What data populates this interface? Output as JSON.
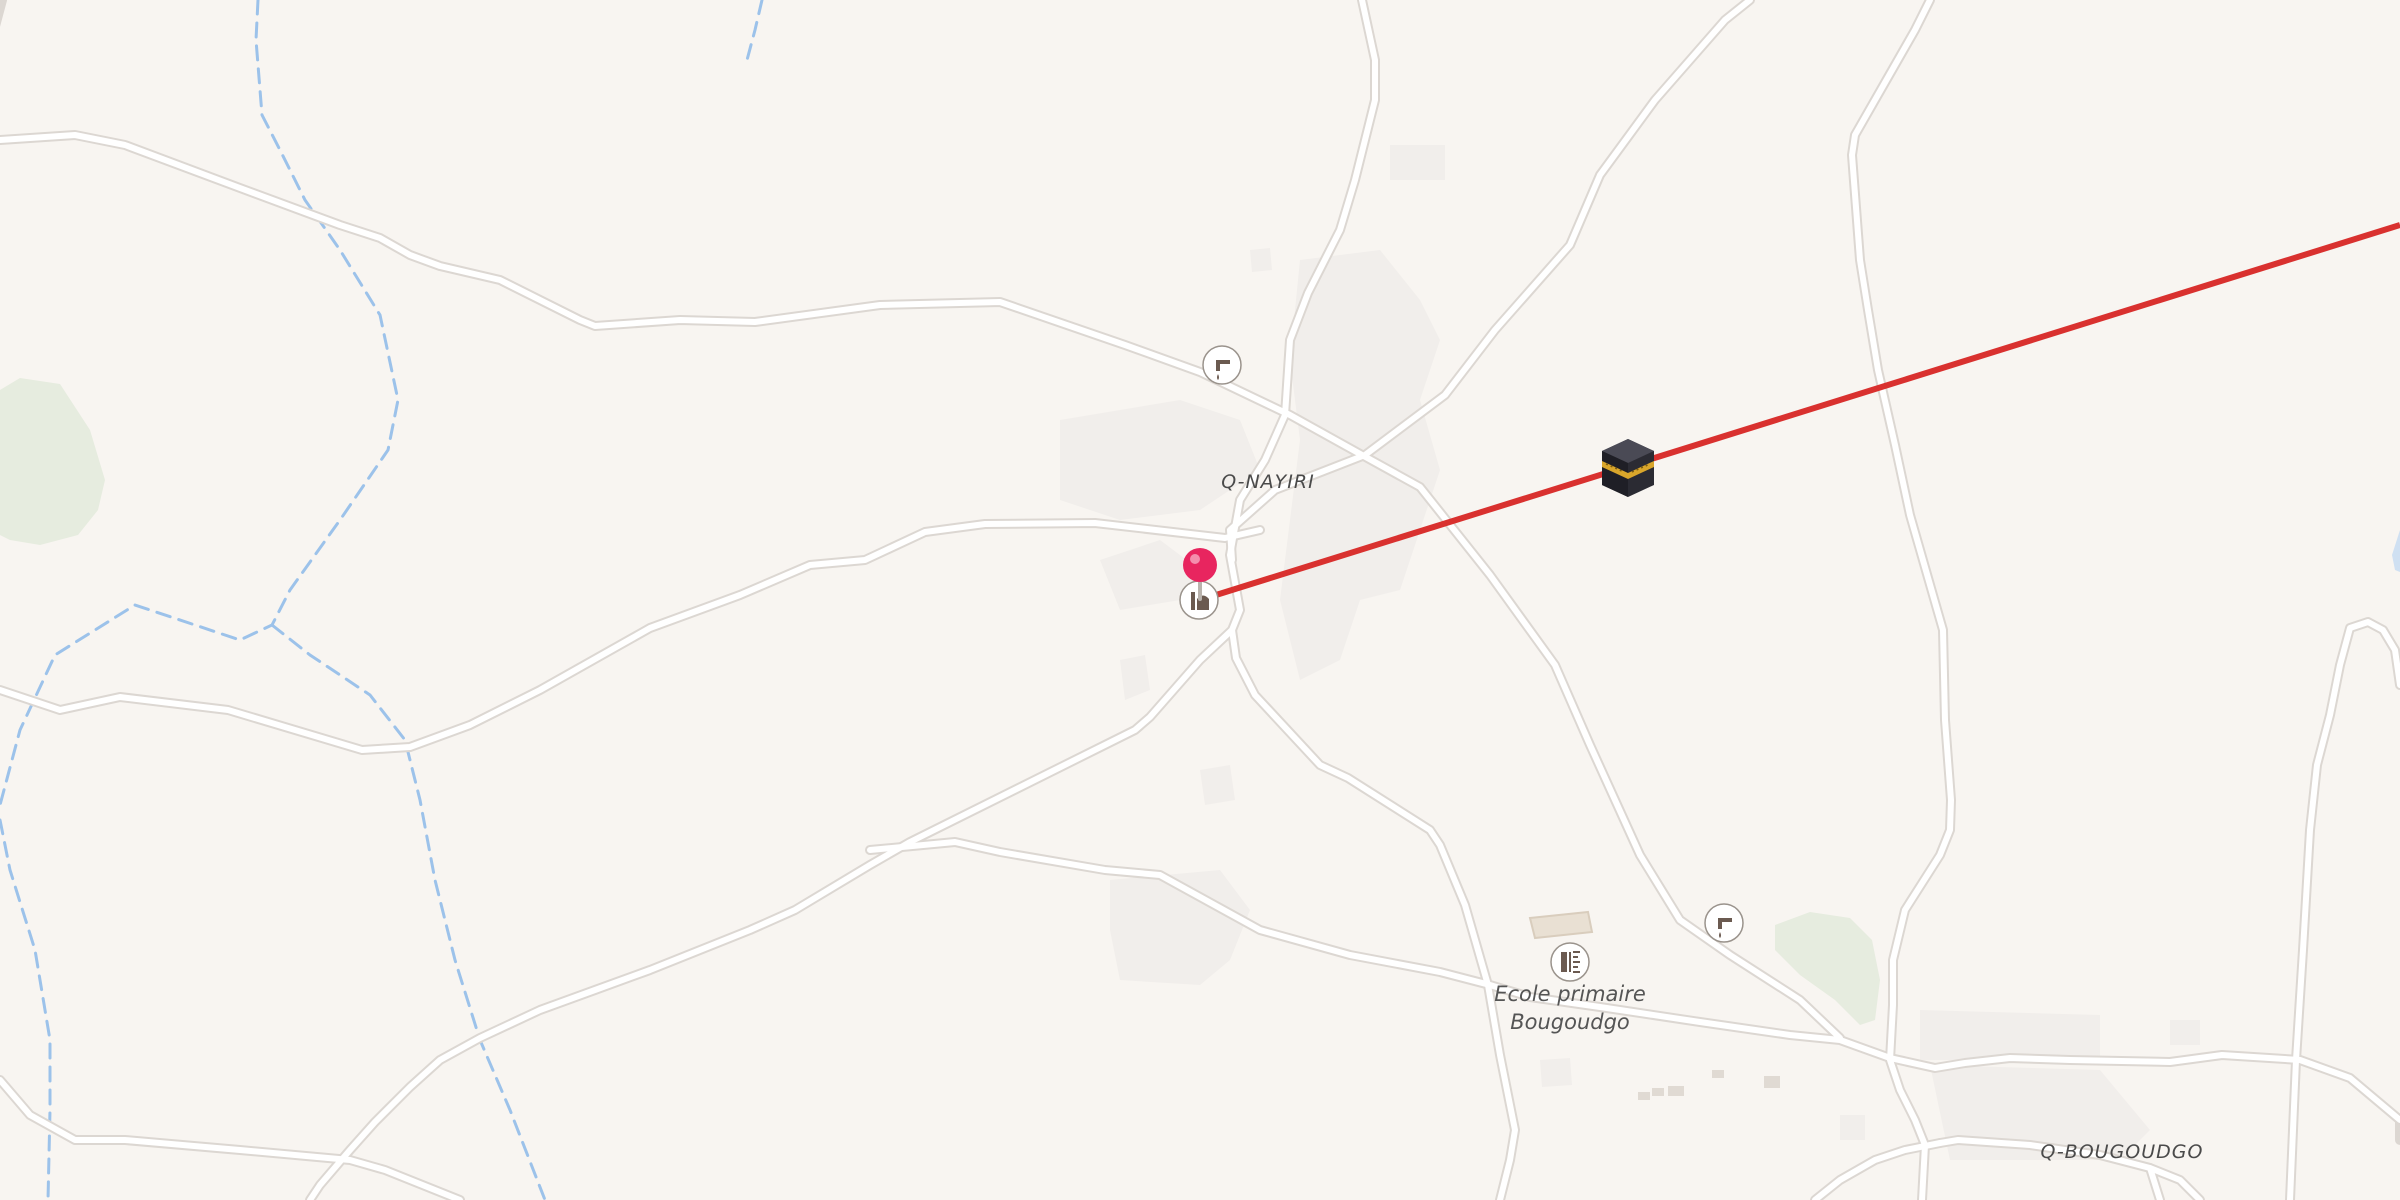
{
  "map": {
    "places": [
      {
        "id": "q-nayiri",
        "label": "Q-NAYIRI"
      },
      {
        "id": "q-bougoudgo",
        "label": "Q-BOUGOUDGO"
      }
    ],
    "pois": [
      {
        "id": "ecole",
        "label_line1": "Ecole primaire",
        "label_line2": "Bougoudgo",
        "icon": "school-icon"
      },
      {
        "id": "water-1",
        "icon": "water-tap-icon"
      },
      {
        "id": "water-2",
        "icon": "water-tap-icon"
      },
      {
        "id": "mosque",
        "icon": "mosque-icon"
      }
    ],
    "markers": [
      {
        "id": "location-pin",
        "icon": "map-pin-icon",
        "color": "#e8255f"
      },
      {
        "id": "qibla-kaaba",
        "icon": "kaaba-icon"
      }
    ],
    "qibla_line_color": "#d9312f",
    "colors": {
      "background": "#f8f5f1",
      "road": "#ffffff",
      "road_casing": "#dcd7d2",
      "stream": "#9cc2ea",
      "vegetation": "#e6ecdf",
      "built_area": "#f1eeeb"
    }
  }
}
